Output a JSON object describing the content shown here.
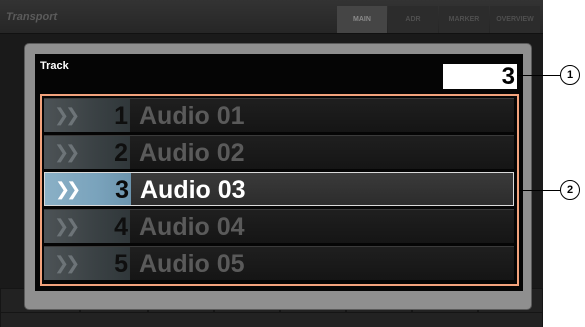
{
  "header": {
    "title": "Transport",
    "tabs": [
      {
        "label": "MAIN",
        "active": true
      },
      {
        "label": "ADR",
        "active": false
      },
      {
        "label": "MARKER",
        "active": false
      },
      {
        "label": "OVERVIEW",
        "active": false
      }
    ]
  },
  "popup": {
    "label": "Track",
    "value": "3",
    "tracks": [
      {
        "number": "1",
        "name": "Audio 01",
        "selected": false
      },
      {
        "number": "2",
        "name": "Audio 02",
        "selected": false
      },
      {
        "number": "3",
        "name": "Audio 03",
        "selected": true
      },
      {
        "number": "4",
        "name": "Audio 04",
        "selected": false
      },
      {
        "number": "5",
        "name": "Audio 05",
        "selected": false
      }
    ]
  },
  "callouts": {
    "one": "1",
    "two": "2"
  },
  "colors": {
    "highlight": "#f2a27c",
    "selected_number_bg": "#8ab0c6"
  }
}
